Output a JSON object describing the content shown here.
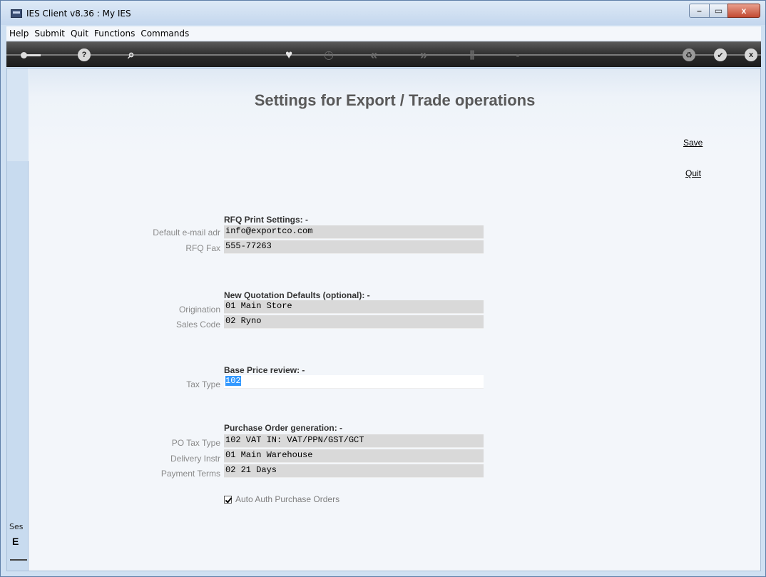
{
  "window": {
    "title": "IES Client v8.36 : My IES",
    "controls": {
      "minimize": "–",
      "maximize": "▭",
      "close": "x"
    }
  },
  "menu": [
    "Help",
    "Submit",
    "Quit",
    "Functions",
    "Commands"
  ],
  "toolbar": {
    "help_glyph": "?",
    "search_glyph": "⌕",
    "heart_glyph": "♥",
    "clock_glyph": "◷",
    "prev_glyph": "«",
    "next_glyph": "»",
    "tools_glyph": "⫼",
    "page_glyph": "▪",
    "recycle_glyph": "♻",
    "ok_glyph": "✔",
    "close_glyph": "x"
  },
  "icons": [
    "key-icon",
    "help-icon",
    "search-icon",
    "heart-icon",
    "clock-icon",
    "prev-icon",
    "next-icon",
    "tools-icon",
    "page-icon",
    "recycle-icon",
    "ok-icon",
    "close-icon"
  ],
  "side": {
    "ses_label": "Ses",
    "glyph": "E"
  },
  "page": {
    "title": "Settings for Export / Trade operations",
    "save_link": "Save",
    "quit_link": "Quit"
  },
  "sections": {
    "rfq": {
      "title": "RFQ Print Settings: -",
      "email_label": "Default e-mail adr",
      "email_value": "info@exportco.com",
      "fax_label": "RFQ Fax",
      "fax_value": "555-77263"
    },
    "quotation": {
      "title": "New Quotation Defaults (optional): -",
      "origination_label": "Origination",
      "origination_value": "01 Main Store",
      "sales_code_label": "Sales Code",
      "sales_code_value": "02 Ryno"
    },
    "base_price": {
      "title": "Base Price review: -",
      "tax_type_label": "Tax Type",
      "tax_type_value": "102"
    },
    "purchase_order": {
      "title": "Purchase Order generation: -",
      "po_tax_type_label": "PO Tax Type",
      "po_tax_type_value": "102 VAT IN: VAT/PPN/GST/GCT",
      "delivery_label": "Delivery Instr",
      "delivery_value": "01 Main Warehouse",
      "payment_label": "Payment Terms",
      "payment_value": "02 21 Days",
      "auto_auth_label": "Auto Auth Purchase Orders",
      "auto_auth_checked": true
    }
  },
  "colors": {
    "toolbar_bg": "#2a2a2a",
    "field_bg": "#d9d9d9",
    "selection": "#3399ff",
    "title_text": "#595959"
  }
}
